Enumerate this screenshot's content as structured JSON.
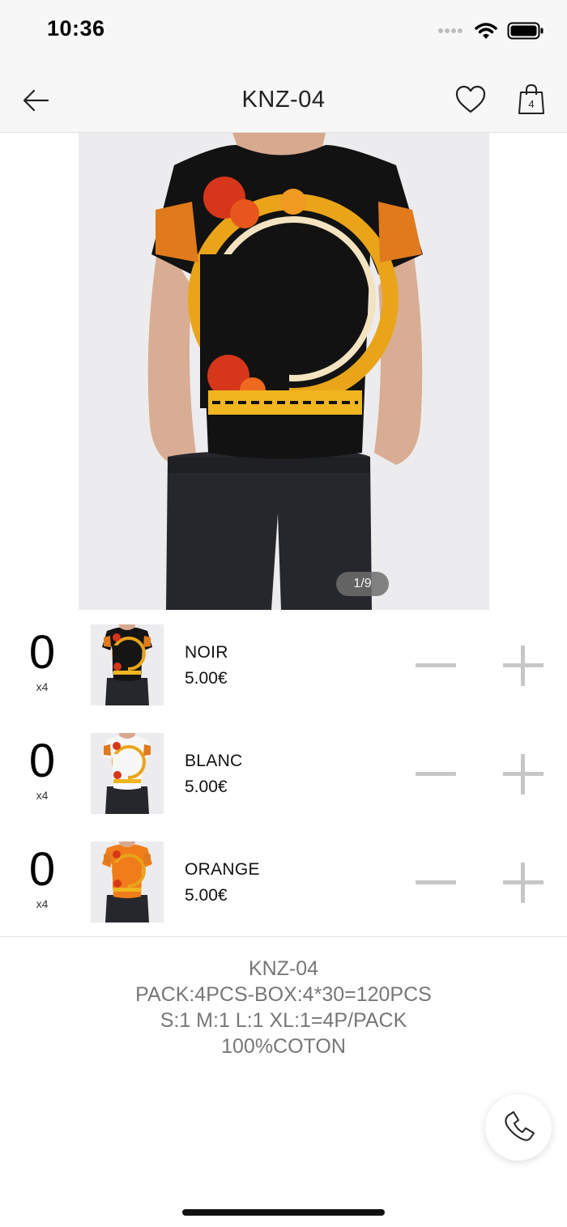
{
  "status_bar": {
    "time": "10:36"
  },
  "header": {
    "title": "KNZ-04",
    "cart_count": "4"
  },
  "gallery": {
    "counter": "1/9"
  },
  "variants": [
    {
      "quantity": "0",
      "multiplier": "x4",
      "name": "NOIR",
      "price": "5.00€",
      "shirt_color": "#151515"
    },
    {
      "quantity": "0",
      "multiplier": "x4",
      "name": "BLANC",
      "price": "5.00€",
      "shirt_color": "#f7f7f7"
    },
    {
      "quantity": "0",
      "multiplier": "x4",
      "name": "ORANGE",
      "price": "5.00€",
      "shirt_color": "#f07d1a"
    }
  ],
  "description": {
    "lines": [
      "KNZ-04",
      "PACK:4PCS-BOX:4*30=120PCS",
      "S:1 M:1 L:1 XL:1=4P/PACK",
      "100%COTON"
    ]
  },
  "icons": {
    "back": "arrow-left-icon",
    "favorite": "heart-icon",
    "cart": "shopping-bag-icon",
    "call": "phone-icon"
  }
}
